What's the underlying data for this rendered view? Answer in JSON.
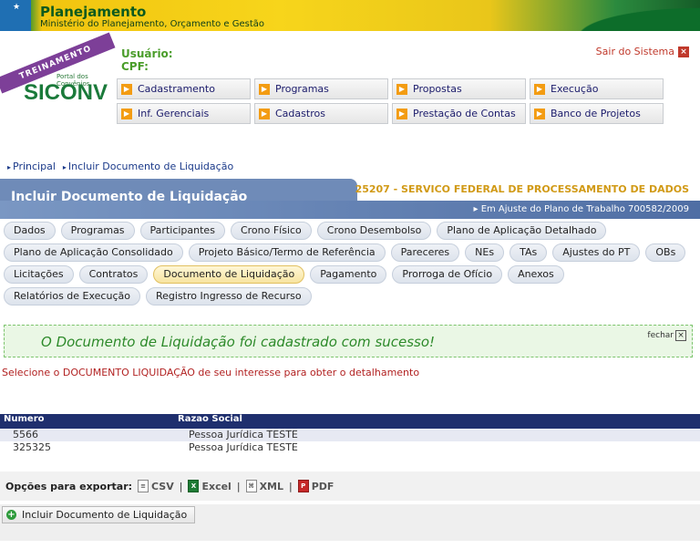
{
  "banner": {
    "title": "Planejamento",
    "subtitle": "Ministério do Planejamento, Orçamento e Gestão"
  },
  "logo": {
    "ribbon": "TREINAMENTO",
    "portal": "Portal dos Convênios",
    "name": "SICONV"
  },
  "user": {
    "usuario_label": "Usuário:",
    "cpf_label": "CPF:"
  },
  "logout_label": "Sair do Sistema",
  "menu": [
    "Cadastramento",
    "Programas",
    "Propostas",
    "Execução",
    "Inf. Gerenciais",
    "Cadastros",
    "Prestação de Contas",
    "Banco de Projetos"
  ],
  "breadcrumb": [
    "Principal",
    "Incluir Documento de Liquidação"
  ],
  "page_title": "Incluir Documento de Liquidação",
  "organization": "25207 - SERVICO FEDERAL DE PROCESSAMENTO DE DADOS",
  "status_text": "Em Ajuste do Plano de Trabalho 700582/2009",
  "tabs": [
    "Dados",
    "Programas",
    "Participantes",
    "Crono Físico",
    "Crono Desembolso",
    "Plano de Aplicação Detalhado",
    "Plano de Aplicação Consolidado",
    "Projeto Básico/Termo de Referência",
    "Pareceres",
    "NEs",
    "TAs",
    "Ajustes do PT",
    "OBs",
    "Licitações",
    "Contratos",
    "Documento de Liquidação",
    "Pagamento",
    "Prorroga de Ofício",
    "Anexos",
    "Relatórios de Execução",
    "Registro Ingresso de Recurso"
  ],
  "active_tab": "Documento de Liquidação",
  "success": {
    "message": "O Documento de Liquidação foi cadastrado com sucesso!",
    "close_label": "fechar"
  },
  "instruction": "Selecione o DOCUMENTO LIQUIDAÇÃO de seu interesse para obter o detalhamento",
  "table": {
    "headers": [
      "Numero",
      "Razao Social"
    ],
    "rows": [
      [
        "5566",
        "Pessoa Jurídica TESTE"
      ],
      [
        "325325",
        "Pessoa Jurídica TESTE"
      ]
    ]
  },
  "export": {
    "label": "Opções para exportar:",
    "options": [
      "CSV",
      "Excel",
      "XML",
      "PDF"
    ]
  },
  "add_button": "Incluir Documento de Liquidação"
}
